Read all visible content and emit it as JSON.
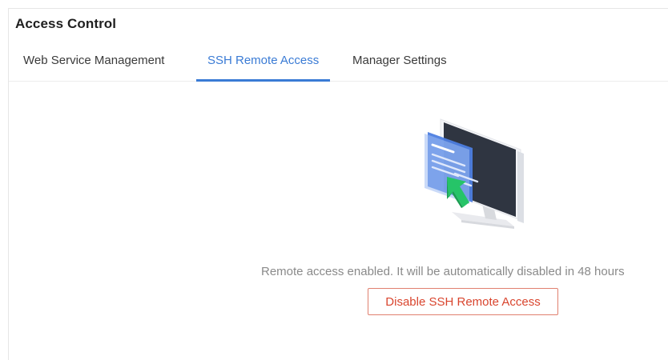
{
  "page": {
    "title": "Access Control"
  },
  "tabs": [
    {
      "label": "Web Service Management",
      "active": false
    },
    {
      "label": "SSH Remote Access",
      "active": true
    },
    {
      "label": "Manager Settings",
      "active": false
    }
  ],
  "ssh": {
    "status_message": "Remote access enabled. It will be automatically disabled in 48 hours",
    "disable_button_label": "Disable SSH Remote Access",
    "illustration_icon": "remote-access-monitor-illustration"
  },
  "colors": {
    "accent": "#3a7bd5",
    "danger": "#d9452e",
    "arrow": "#2ecc71"
  }
}
